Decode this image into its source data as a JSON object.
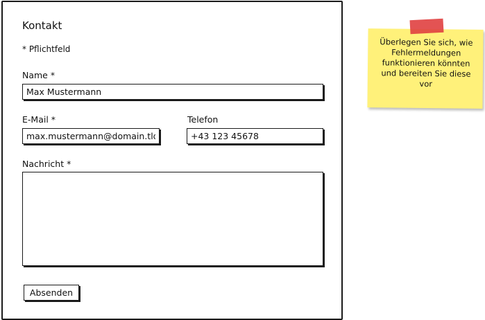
{
  "form": {
    "title": "Kontakt",
    "required_note": "* Pflichtfeld",
    "name": {
      "label": "Name *",
      "value": "Max Mustermann"
    },
    "email": {
      "label": "E-Mail *",
      "value": "max.mustermann@domain.tld"
    },
    "phone": {
      "label": "Telefon",
      "value": "+43 123 45678"
    },
    "message": {
      "label": "Nachricht *",
      "value": ""
    },
    "submit_label": "Absenden"
  },
  "sticky_note": {
    "text": "Überlegen Sie sich, wie Fehlermeldungen funktionieren könnten und bereiten Sie diese vor",
    "color": "#fff17a",
    "tape_color": "#e04040"
  }
}
